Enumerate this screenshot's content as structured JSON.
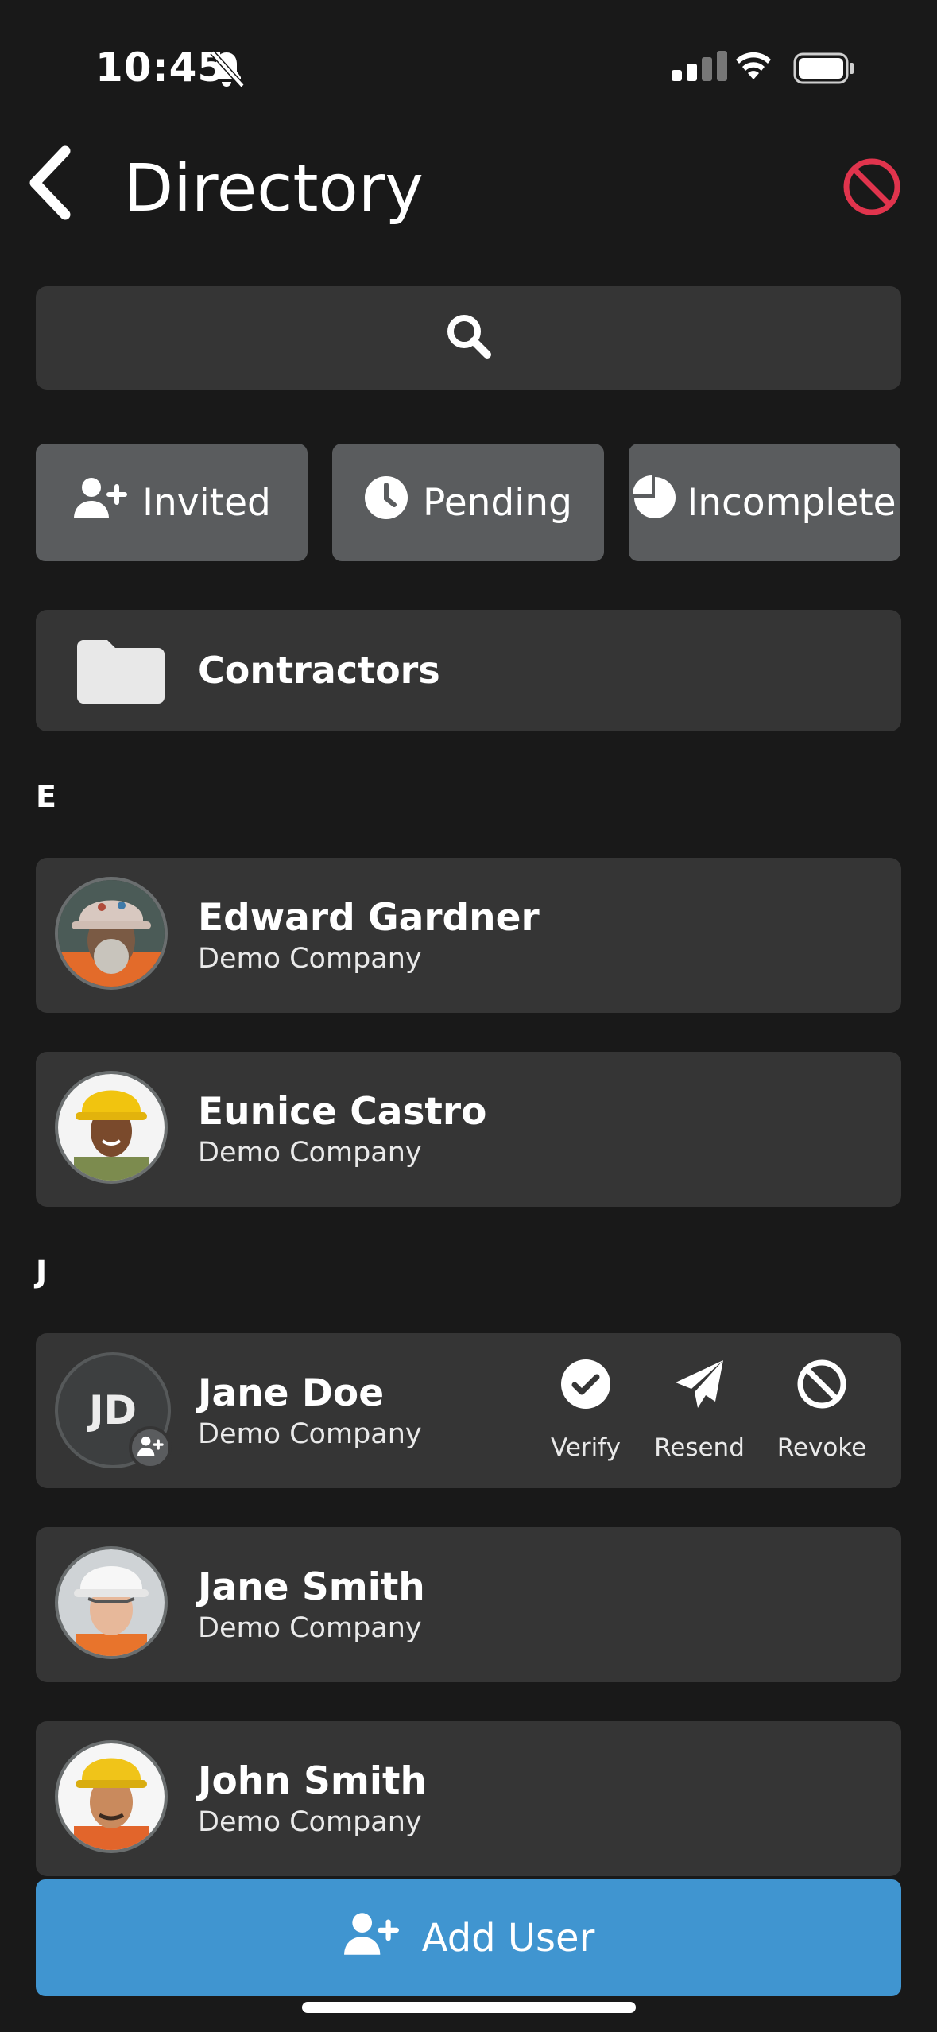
{
  "status_bar": {
    "time": "10:45",
    "icons": [
      "bell-slash-icon",
      "signal-icon",
      "wifi-icon",
      "battery-icon"
    ]
  },
  "header": {
    "title": "Directory",
    "back_icon": "chevron-left-icon",
    "action_icon": "block-icon",
    "action_color": "#e0344d"
  },
  "search": {
    "icon": "search-icon"
  },
  "filters": [
    {
      "label": "Invited",
      "icon": "user-plus-icon"
    },
    {
      "label": "Pending",
      "icon": "clock-icon"
    },
    {
      "label": "Incomplete",
      "icon": "pie-icon"
    }
  ],
  "folder": {
    "label": "Contractors",
    "icon": "folder-icon"
  },
  "sections": [
    {
      "letter": "E",
      "users": [
        {
          "name": "Edward Gardner",
          "company": "Demo Company",
          "avatar": "photo"
        },
        {
          "name": "Eunice Castro",
          "company": "Demo Company",
          "avatar": "photo"
        }
      ]
    },
    {
      "letter": "J",
      "users": [
        {
          "name": "Jane Doe",
          "company": "Demo Company",
          "initials": "JD",
          "badge_icon": "user-plus-icon",
          "actions": [
            {
              "label": "Verify",
              "icon": "check-circle-icon"
            },
            {
              "label": "Resend",
              "icon": "paper-plane-icon"
            },
            {
              "label": "Revoke",
              "icon": "block-icon"
            }
          ]
        },
        {
          "name": "Jane Smith",
          "company": "Demo Company",
          "avatar": "photo"
        },
        {
          "name": "John Smith",
          "company": "Demo Company",
          "avatar": "photo"
        }
      ]
    }
  ],
  "add_user": {
    "label": "Add User",
    "icon": "user-plus-icon",
    "color": "#4095d0"
  }
}
